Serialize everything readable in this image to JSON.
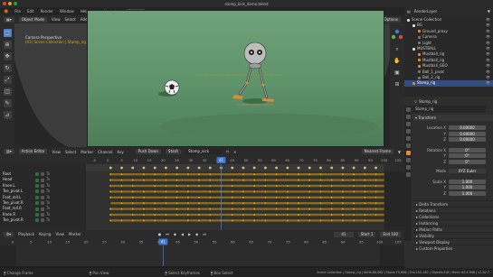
{
  "window": {
    "title": "stomp_kick_demo.blend"
  },
  "topbar": {
    "menus": [
      "File",
      "Edit",
      "Render",
      "Window",
      "Help"
    ],
    "workspaces": [
      "Modeling",
      "Layout"
    ],
    "active_workspace": "Layout",
    "scene": "Scene",
    "view_layer": "RenderLayer"
  },
  "viewport": {
    "mode": "Object Mode",
    "menus": [
      "View",
      "Select",
      "Add",
      "Object"
    ],
    "orientation": "Global",
    "options_label": "Options",
    "overlay_line1": "Camera Perspective",
    "overlay_line2": "(41) Scene Collection | Stomp_rig"
  },
  "outliner": {
    "items": [
      {
        "label": "Scene Collection",
        "level": 0,
        "color": "#dddddd",
        "sel": false
      },
      {
        "label": "BG",
        "level": 1,
        "color": "#dddddd",
        "sel": false
      },
      {
        "label": "Ground_proxy",
        "level": 2,
        "color": "#e08a35",
        "sel": false
      },
      {
        "label": "Camera",
        "level": 2,
        "color": "#777777",
        "sel": false
      },
      {
        "label": "Light",
        "level": 2,
        "color": "#777777",
        "sel": false
      },
      {
        "label": "MUSTBALL",
        "level": 1,
        "color": "#dddddd",
        "sel": false
      },
      {
        "label": "Mustball_rig",
        "level": 2,
        "color": "#e08a35",
        "sel": false
      },
      {
        "label": "Mustball_rig",
        "level": 2,
        "color": "#e08a35",
        "sel": false
      },
      {
        "label": "Mustball_GEO",
        "level": 2,
        "color": "#e08a35",
        "sel": false
      },
      {
        "label": "Ball_1_pivot",
        "level": 2,
        "color": "#777777",
        "sel": false
      },
      {
        "label": "Ball_2_rig",
        "level": 2,
        "color": "#777777",
        "sel": false
      },
      {
        "label": "Stomp_rig",
        "level": 1,
        "color": "#e08a35",
        "sel": true
      }
    ]
  },
  "properties": {
    "object_name": "Stomp_rig",
    "transform_label": "Transform",
    "location_label": "Location X",
    "location": [
      "0.00000",
      "0.00000",
      "0.00000"
    ],
    "rotation_label": "Rotation X",
    "rotation": [
      "0°",
      "0°",
      "0°"
    ],
    "mode_label": "Mode",
    "mode_value": "XYZ Euler",
    "scale_label": "Scale X",
    "scale": [
      "1.000",
      "1.000",
      "1.000"
    ],
    "delta_label": "Delta Transform",
    "collapsed": [
      "Relations",
      "Collections",
      "Instancing",
      "Motion Paths",
      "Visibility",
      "Viewport Display",
      "Custom Properties"
    ]
  },
  "dopesheet": {
    "editor": "Action Editor",
    "menus": [
      "View",
      "Select",
      "Marker",
      "Channel",
      "Key"
    ],
    "push_down": "Push Down",
    "stash": "Stash",
    "action": "Stomp_kick",
    "snap": "Nearest Frame",
    "channels": [
      "Root",
      "Head",
      "Knee.L",
      "Toe_pivot.L",
      "Foot_roll.L",
      "Toe_pivot.R",
      "Foot_roll.R",
      "Knee.R",
      "Toe_pivot.R"
    ],
    "frame_ticks": [
      "-5",
      "0",
      "5",
      "10",
      "15",
      "20",
      "25",
      "30",
      "35",
      "40",
      "45",
      "50",
      "55",
      "60",
      "65",
      "70",
      "75",
      "80",
      "85",
      "90",
      "95",
      "100",
      "105"
    ],
    "current_frame": "41"
  },
  "timeline": {
    "menus": [
      "Playback",
      "Keying",
      "View",
      "Marker"
    ],
    "frame_ticks": [
      "0",
      "5",
      "10",
      "15",
      "20",
      "25",
      "30",
      "35",
      "40",
      "45",
      "50",
      "55",
      "60",
      "65",
      "70",
      "75",
      "80",
      "85",
      "90",
      "95",
      "100",
      "105"
    ],
    "current_frame": "41",
    "start_label": "Start",
    "start": "1",
    "end_label": "End",
    "end": "100"
  },
  "status": {
    "items": [
      "Change Frame",
      "Pan View",
      "Select Keyframes",
      "Box Select"
    ],
    "info": "Scene Collection | Stomp_rig | Verts:80,082 | Faces:75,696 | Tris:150,140 | Objects:1/6 | Mem: 62.4 MiB | v2.82.7"
  },
  "colors": {
    "accent": "#3b78d4",
    "key": "#e0a400",
    "ground": "#5e9269"
  }
}
